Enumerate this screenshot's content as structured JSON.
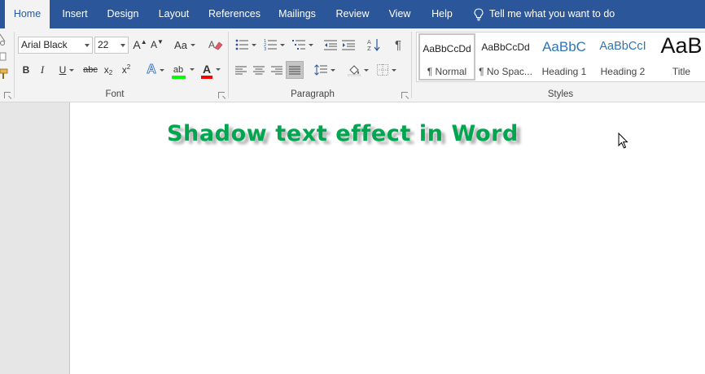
{
  "tabs": [
    {
      "label": "Home",
      "active": true
    },
    {
      "label": "Insert"
    },
    {
      "label": "Design"
    },
    {
      "label": "Layout"
    },
    {
      "label": "References"
    },
    {
      "label": "Mailings"
    },
    {
      "label": "Review"
    },
    {
      "label": "View"
    },
    {
      "label": "Help"
    }
  ],
  "tell_me": "Tell me what you want to do",
  "font_group": {
    "label": "Font",
    "font_name": "Arial Black",
    "font_size": "22",
    "grow_glyph": "A",
    "shrink_glyph": "A",
    "change_case": "Aa",
    "bold": "B",
    "italic": "I",
    "underline": "U",
    "strikethrough": "abc",
    "subscript": "x",
    "subscript_mark": "2",
    "superscript": "x",
    "superscript_mark": "2",
    "text_effects": "A",
    "highlight": "ab",
    "font_color": "A",
    "highlight_color": "#00ff00",
    "font_color_value": "#ff0000"
  },
  "paragraph_group": {
    "label": "Paragraph",
    "pilcrow": "¶"
  },
  "styles_group": {
    "label": "Styles",
    "items": [
      {
        "preview": "AaBbCcDd",
        "name": "¶ Normal",
        "selected": true
      },
      {
        "preview": "AaBbCcDd",
        "name": "¶ No Spac..."
      },
      {
        "preview": "AaBbC",
        "name": "Heading 1"
      },
      {
        "preview": "AaBbCcI",
        "name": "Heading 2"
      },
      {
        "preview": "AaB",
        "name": "Title"
      }
    ]
  },
  "document": {
    "heading": "Shadow text effect in Word",
    "heading_color": "#00a550"
  },
  "colors": {
    "tab_bar": "#2b579a",
    "ribbon": "#f3f3f3",
    "heading_style": "#2e74b5"
  }
}
